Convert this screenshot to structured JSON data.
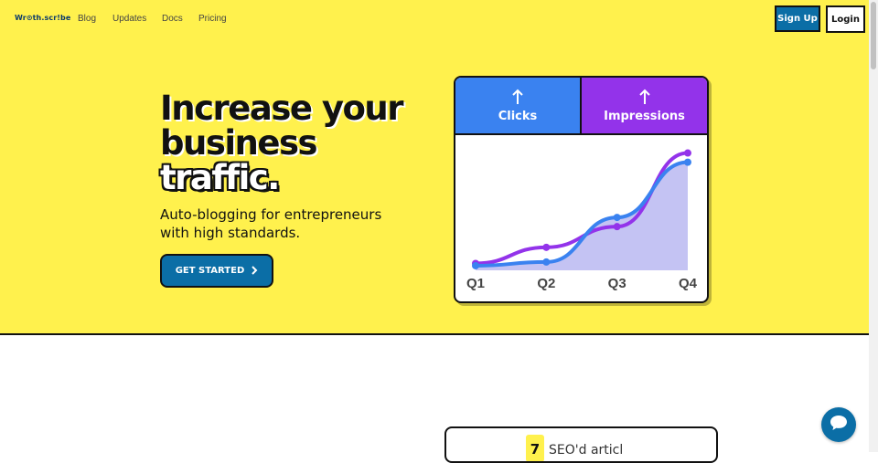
{
  "nav": {
    "logo": "Wr⊙th.scr!be",
    "links": [
      "Blog",
      "Updates",
      "Docs",
      "Pricing"
    ],
    "signup_label": "Sign Up",
    "login_label": "Login"
  },
  "hero": {
    "headline_line1": "Increase your",
    "headline_line2": "business",
    "headline_line3": "traffic.",
    "subhead": "Auto-blogging for entrepreneurs with high standards.",
    "cta_label": "GET STARTED",
    "cta_icon": "chevron-right-icon"
  },
  "metrics_card": {
    "tabs": [
      {
        "label": "Clicks",
        "icon": "arrow-up-icon",
        "color": "#3a82f0"
      },
      {
        "label": "Impressions",
        "icon": "arrow-up-icon",
        "color": "#9333ea"
      }
    ]
  },
  "chart_data": {
    "type": "line",
    "categories": [
      "Q1",
      "Q2",
      "Q3",
      "Q4"
    ],
    "series": [
      {
        "name": "Clicks",
        "color": "#3a82f0",
        "values": [
          1.0,
          1.8,
          11.5,
          23.5
        ],
        "fill": "#c4c3f3"
      },
      {
        "name": "Impressions",
        "color": "#9333ea",
        "values": [
          1.5,
          5.0,
          9.5,
          25.5
        ]
      }
    ],
    "ylim": [
      0,
      27
    ],
    "xlabel": "",
    "ylabel": "",
    "grid": false,
    "legend": "top"
  },
  "feature": {
    "number": "7",
    "text": "SEO'd articl"
  },
  "colors": {
    "hero_bg": "#fff14d",
    "primary": "#0b6ea6"
  },
  "chat": {
    "icon": "chat-bubble-icon"
  }
}
